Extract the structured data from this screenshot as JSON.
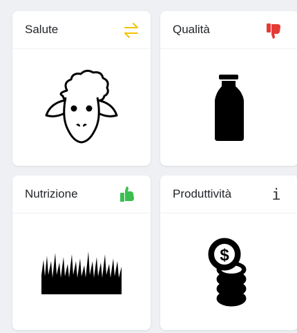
{
  "cards": [
    {
      "title": "Salute",
      "status_icon": "swap-arrows-icon",
      "status_color": "#f2c200",
      "illustration": "sheep-icon"
    },
    {
      "title": "Qualità",
      "status_icon": "thumbs-down-icon",
      "status_color": "#e53935",
      "illustration": "milk-bottle-icon"
    },
    {
      "title": "Nutrizione",
      "status_icon": "thumbs-up-icon",
      "status_color": "#3bbf4f",
      "illustration": "grass-icon"
    },
    {
      "title": "Produttività",
      "status_icon": "info-icon",
      "status_color": "#333333",
      "illustration": "coins-icon",
      "status_glyph": "i"
    }
  ]
}
